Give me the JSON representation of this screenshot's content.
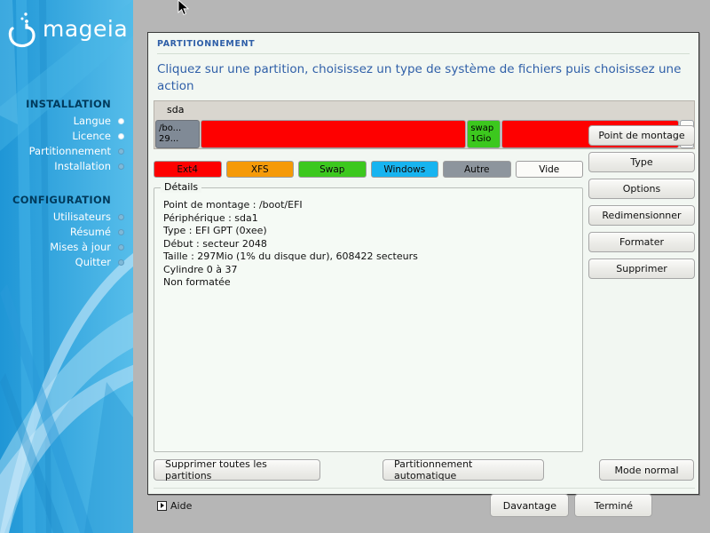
{
  "sidebar": {
    "logo_text": "mageia",
    "logo_icon": "mageia-cauldron-logo",
    "sections": [
      {
        "heading": "INSTALLATION",
        "items": [
          {
            "label": "Langue",
            "done": true
          },
          {
            "label": "Licence",
            "done": true
          },
          {
            "label": "Partitionnement",
            "done": false
          },
          {
            "label": "Installation",
            "done": false
          }
        ]
      },
      {
        "heading": "CONFIGURATION",
        "items": [
          {
            "label": "Utilisateurs",
            "done": false
          },
          {
            "label": "Résumé",
            "done": false
          },
          {
            "label": "Mises à jour",
            "done": false
          },
          {
            "label": "Quitter",
            "done": false
          }
        ]
      }
    ]
  },
  "dialog": {
    "title": "PARTITIONNEMENT",
    "instruction": "Cliquez sur une partition, choisissez un type de système de fichiers puis choisissez une action"
  },
  "disk": {
    "name": "sda",
    "partitions": [
      {
        "id": "sda1",
        "label_line1": "/bo...",
        "label_line2": "29...",
        "color": "#808a96",
        "width_pct": 8.2,
        "selected": true
      },
      {
        "id": "sda2",
        "label_line1": "",
        "label_line2": "",
        "color": "#fe0000",
        "width_pct": 49.5,
        "selected": false
      },
      {
        "id": "sda3",
        "label_line1": "swap",
        "label_line2": "1Gio",
        "color": "#3cc81e",
        "width_pct": 6.3,
        "selected": false
      },
      {
        "id": "sda4",
        "label_line1": "",
        "label_line2": "",
        "color": "#fe0000",
        "width_pct": 33.0,
        "selected": false
      },
      {
        "id": "free",
        "label_line1": "",
        "label_line2": "",
        "color": "#fbfbf8",
        "width_pct": 2.6,
        "selected": false
      }
    ]
  },
  "legend": [
    {
      "label": "Ext4",
      "color": "#fe0000"
    },
    {
      "label": "XFS",
      "color": "#f59a08"
    },
    {
      "label": "Swap",
      "color": "#3cc81e"
    },
    {
      "label": "Windows",
      "color": "#17b4f0"
    },
    {
      "label": "Autre",
      "color": "#8d959d"
    },
    {
      "label": "Vide",
      "color": "#fbfbf8"
    }
  ],
  "actions": [
    "Point de montage",
    "Type",
    "Options",
    "Redimensionner",
    "Formater",
    "Supprimer"
  ],
  "details": {
    "legend": "Détails",
    "lines": [
      "Point de montage : /boot/EFI",
      "Périphérique : sda1",
      "Type : EFI GPT (0xee)",
      "Début : secteur 2048",
      "Taille : 297Mio (1% du disque dur), 608422 secteurs",
      "Cylindre 0 à 37",
      "Non formatée"
    ]
  },
  "bottom": {
    "delete_all": "Supprimer toutes les partitions",
    "auto_partition": "Partitionnement automatique",
    "normal_mode": "Mode normal",
    "help": "Aide",
    "help_icon": "expander-triangle-icon",
    "more": "Davantage",
    "done": "Terminé"
  }
}
